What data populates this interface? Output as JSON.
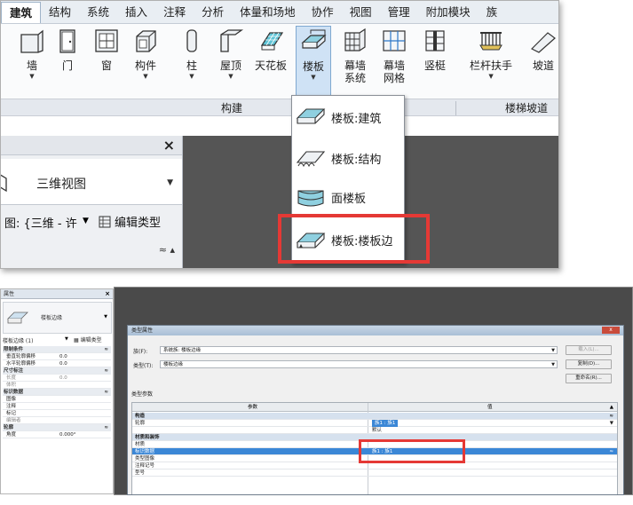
{
  "ribbon": {
    "tabs": [
      "建筑",
      "结构",
      "系统",
      "插入",
      "注释",
      "分析",
      "体量和场地",
      "协作",
      "视图",
      "管理",
      "附加模块",
      "族"
    ],
    "active_tab_index": 0,
    "tools": {
      "wall": "墙",
      "door": "门",
      "window": "窗",
      "component": "构件",
      "column": "柱",
      "roof": "屋顶",
      "ceiling": "天花板",
      "floor": "楼板",
      "curtain_system_1": "幕墙",
      "curtain_system_2": "系统",
      "curtain_grid_1": "幕墙",
      "curtain_grid_2": "网格",
      "mullion": "竖梃",
      "railing": "栏杆扶手",
      "ramp": "坡道"
    },
    "panels": {
      "build": "构建",
      "circulation": "楼梯坡道"
    }
  },
  "floor_menu": {
    "items": [
      "楼板:建筑",
      "楼板:结构",
      "面楼板",
      "楼板:楼板边"
    ]
  },
  "left_panel": {
    "close": "×",
    "type_name": "三维视图",
    "view_selector": "图: {三维 - 许",
    "edit_type": "编辑类型",
    "scroll_glyphs": "≈ ▴"
  },
  "properties": {
    "title": "属性",
    "close": "×",
    "type_name": "楼板边缘",
    "selector": "楼板边缘 (1)",
    "edit_type": "编辑类型",
    "rows": [
      {
        "k": "限制条件",
        "v": "",
        "group": true
      },
      {
        "k": "垂直轮廓偏移",
        "v": "0.0",
        "group": false
      },
      {
        "k": "水平轮廓偏移",
        "v": "0.0",
        "group": false
      },
      {
        "k": "尺寸标注",
        "v": "",
        "group": true
      },
      {
        "k": "长度",
        "v": "0.0",
        "group": false
      },
      {
        "k": "体积",
        "v": "",
        "group": false
      },
      {
        "k": "标识数据",
        "v": "",
        "group": true
      },
      {
        "k": "图像",
        "v": "",
        "group": false
      },
      {
        "k": "注释",
        "v": "",
        "group": false
      },
      {
        "k": "标记",
        "v": "",
        "group": false
      },
      {
        "k": "编辑者",
        "v": "",
        "group": false
      },
      {
        "k": "轮廓",
        "v": "",
        "group": true
      },
      {
        "k": "角度",
        "v": "0.000°",
        "group": false
      }
    ]
  },
  "type_dialog": {
    "title": "类型属性",
    "close": "x",
    "family_label": "族(F):",
    "family_value": "系统族: 楼板边缘",
    "type_label": "类型(T):",
    "type_value": "楼板边缘",
    "load_button": "载入(L)...",
    "duplicate_button": "复制(D)...",
    "rename_button": "重命名(R)...",
    "section_label": "类型参数",
    "col_param": "参数",
    "col_value": "值",
    "rows": [
      {
        "k": "构造",
        "v": "",
        "style": "group"
      },
      {
        "k": "轮廓",
        "v": "族1 : 族1",
        "style": "normal"
      },
      {
        "k": "",
        "v": "默认",
        "style": "normal"
      },
      {
        "k": "材质和装饰",
        "v": "",
        "style": "group"
      },
      {
        "k": "材质",
        "v": "",
        "style": "normal"
      },
      {
        "k": "标识数据",
        "v": "族1 : 族1",
        "style": "sel"
      },
      {
        "k": "类型图像",
        "v": "",
        "style": "normal"
      },
      {
        "k": "注释记号",
        "v": "",
        "style": "normal"
      },
      {
        "k": "型号",
        "v": "",
        "style": "normal"
      }
    ]
  }
}
